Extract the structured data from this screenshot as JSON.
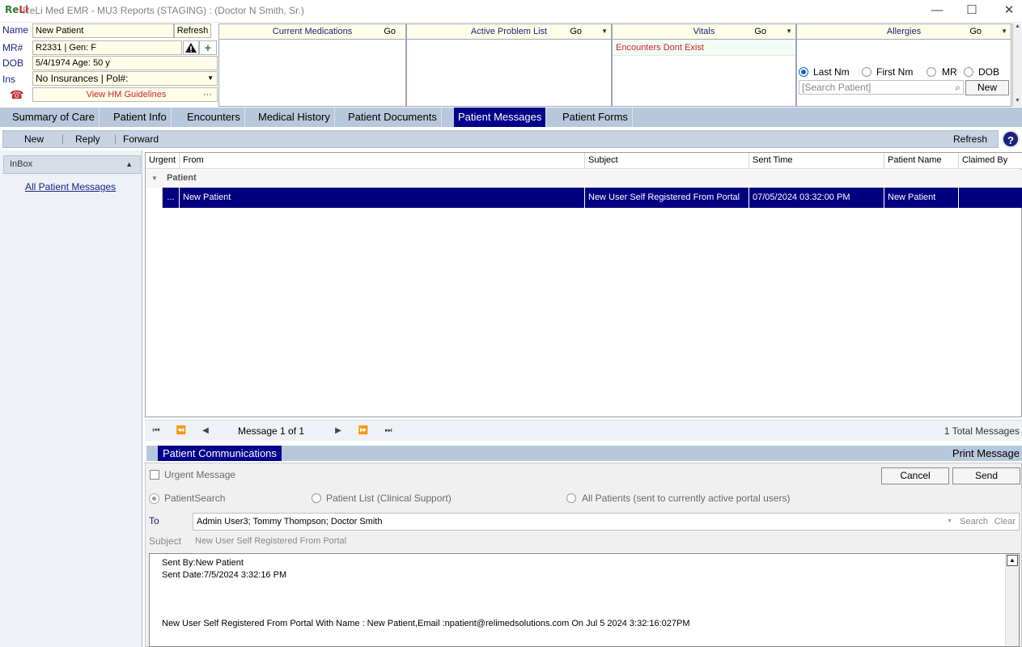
{
  "window": {
    "logo": "ReLi",
    "title": "ReLi Med EMR - MU3 Reports (STAGING) : (Doctor N Smith, Sr.)",
    "controls": [
      "—",
      "☐",
      "✕"
    ]
  },
  "patient": {
    "name_label": "Name",
    "name": "New Patient",
    "refresh": "Refresh",
    "mr_label": "MR#",
    "mr": "R2331 | Gen: F",
    "dob_label": "DOB",
    "dob": "5/4/1974  Age: 50 y",
    "ins_label": "Ins",
    "ins": "No Insurances | Pol#:",
    "hm": "View HM Guidelines",
    "hm_more": "···"
  },
  "panels": {
    "medications": {
      "title": "Current Medications",
      "go": "Go"
    },
    "problems": {
      "title": "Active Problem List",
      "go": "Go"
    },
    "vitals": {
      "title": "Vitals",
      "go": "Go",
      "message": "Encounters Dont Exist"
    },
    "allergies": {
      "title": "Allergies",
      "go": "Go"
    }
  },
  "search": {
    "options": [
      "Last Nm",
      "First Nm",
      "MR",
      "DOB"
    ],
    "selected": "Last Nm",
    "placeholder": "[Search Patient]",
    "new_button": "New"
  },
  "tabs": [
    "Summary of Care",
    "Patient Info",
    "Encounters",
    "Medical History",
    "Patient Documents",
    "Patient Messages",
    "Patient Forms"
  ],
  "active_tab": "Patient Messages",
  "toolbar": {
    "new": "New",
    "reply": "Reply",
    "forward": "Forward",
    "refresh": "Refresh",
    "help": "?"
  },
  "sidebar": {
    "inbox": "InBox",
    "all_messages": "All Patient Messages"
  },
  "grid": {
    "columns": [
      "Urgent",
      "From",
      "Subject",
      "Sent Time",
      "Patient Name",
      "Claimed By"
    ],
    "group": "Patient",
    "rows": [
      {
        "urgent": "...",
        "from": "New Patient",
        "subject": "New User Self Registered From Portal",
        "sent_time": "07/05/2024 03:32:00 PM",
        "patient_name": "New Patient",
        "claimed_by": ""
      }
    ]
  },
  "pager": {
    "message": "Message 1 of 1",
    "total": "1 Total Messages"
  },
  "comm": {
    "title": "Patient Communications",
    "print": "Print Message",
    "urgent": "Urgent Message",
    "cancel": "Cancel",
    "send": "Send",
    "radio_search": "PatientSearch",
    "radio_list": "Patient List (Clinical Support)",
    "radio_all": "All Patients (sent to currently active portal users)",
    "to_label": "To",
    "to_value": "Admin User3; Tommy Thompson; Doctor Smith",
    "search": "Search",
    "clear": "Clear",
    "subject_label": "Subject",
    "subject_value": "New User Self Registered From Portal",
    "body_line1": "Sent By:New Patient",
    "body_line2": "Sent Date:7/5/2024 3:32:16 PM",
    "body_line3": "New User Self Registered From Portal With Name : New Patient,Email :npatient@relimedsolutions.com On Jul  5 2024  3:32:16:027PM"
  },
  "colors": {
    "accent": "#00008b",
    "tabbar": "#b7c7dc",
    "alert": "#c62828"
  }
}
